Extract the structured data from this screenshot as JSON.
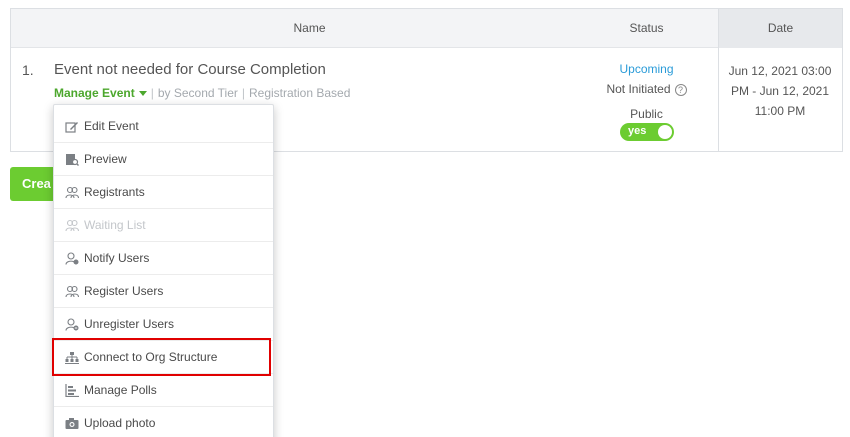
{
  "table": {
    "headers": {
      "name": "Name",
      "status": "Status",
      "date": "Date"
    },
    "row": {
      "number": "1.",
      "title": "Event not needed for Course Completion",
      "manage_label": "Manage Event",
      "tier": "by Second Tier",
      "registration": "Registration Based",
      "separator": "|",
      "status_upcoming": "Upcoming",
      "status_initiated": "Not Initiated",
      "help_glyph": "?",
      "visibility": "Public",
      "toggle_label": "yes",
      "toggle_on": true,
      "date_line1": "Jun 12, 2021 03:00",
      "date_line2": "PM - Jun 12, 2021",
      "date_line3": "11:00 PM"
    }
  },
  "create_button": {
    "label": "Crea"
  },
  "menu": {
    "items": [
      {
        "label": "Edit Event",
        "icon": "edit-icon",
        "disabled": false
      },
      {
        "label": "Preview",
        "icon": "preview-icon",
        "disabled": false
      },
      {
        "label": "Registrants",
        "icon": "users-icon",
        "disabled": false
      },
      {
        "label": "Waiting List",
        "icon": "users-icon",
        "disabled": true
      },
      {
        "label": "Notify Users",
        "icon": "notify-user-icon",
        "disabled": false
      },
      {
        "label": "Register Users",
        "icon": "users-icon",
        "disabled": false
      },
      {
        "label": "Unregister Users",
        "icon": "unregister-user-icon",
        "disabled": false
      },
      {
        "label": "Connect to Org Structure",
        "icon": "org-structure-icon",
        "disabled": false
      },
      {
        "label": "Manage Polls",
        "icon": "polls-icon",
        "disabled": false
      },
      {
        "label": "Upload photo",
        "icon": "camera-icon",
        "disabled": false
      }
    ],
    "highlighted_item": "Connect to Org Structure"
  },
  "colors": {
    "accent_green": "#6ccc31",
    "link_green": "#4ca72d",
    "link_blue": "#2a9bd8",
    "highlight_red": "#e00000"
  }
}
